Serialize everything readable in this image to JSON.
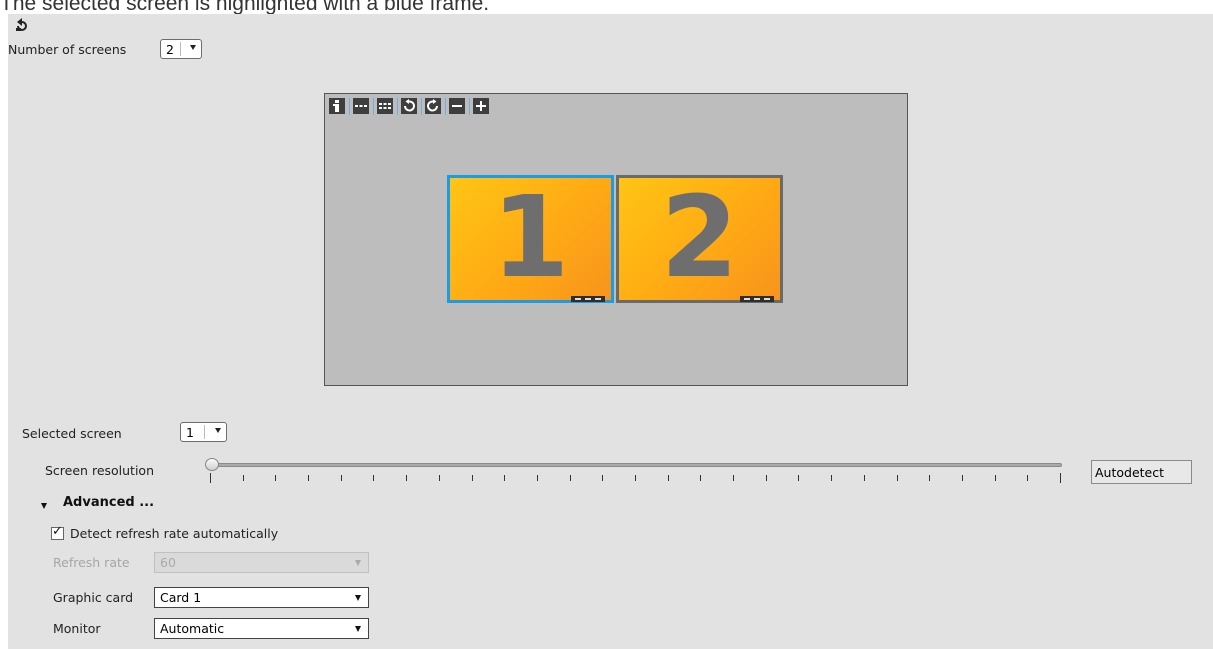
{
  "caption": "The selected screen is highlighted with a blue frame.",
  "number_of_screens": {
    "label": "Number of screens",
    "value": "2"
  },
  "toolbar": {
    "buttons": [
      {
        "name": "info-icon",
        "glyph": "i"
      },
      {
        "name": "layout-row-icon",
        "glyph": "─"
      },
      {
        "name": "layout-grid-icon",
        "glyph": "▓"
      },
      {
        "name": "rotate-left-icon",
        "glyph": "↺"
      },
      {
        "name": "rotate-right-icon",
        "glyph": "↻"
      },
      {
        "name": "zoom-out-icon",
        "glyph": "−"
      },
      {
        "name": "zoom-in-icon",
        "glyph": "+"
      }
    ]
  },
  "screens": [
    {
      "number": "1",
      "selected": true
    },
    {
      "number": "2",
      "selected": false
    }
  ],
  "colors": {
    "selected_frame": "#1c9ce6",
    "unselected_frame": "#6a6a6a",
    "screen_fill": "#ffb81c"
  },
  "selected_screen": {
    "label": "Selected screen",
    "value": "1"
  },
  "resolution": {
    "label": "Screen resolution",
    "value": "Autodetect",
    "tick_count": 27,
    "slider_position": 0
  },
  "advanced": {
    "label": "Advanced ...",
    "detect_refresh": {
      "label": "Detect refresh rate automatically",
      "checked": true
    },
    "refresh_rate": {
      "label": "Refresh rate",
      "value": "60",
      "disabled": true
    },
    "graphic_card": {
      "label": "Graphic card",
      "value": "Card 1"
    },
    "monitor": {
      "label": "Monitor",
      "value": "Automatic"
    }
  }
}
